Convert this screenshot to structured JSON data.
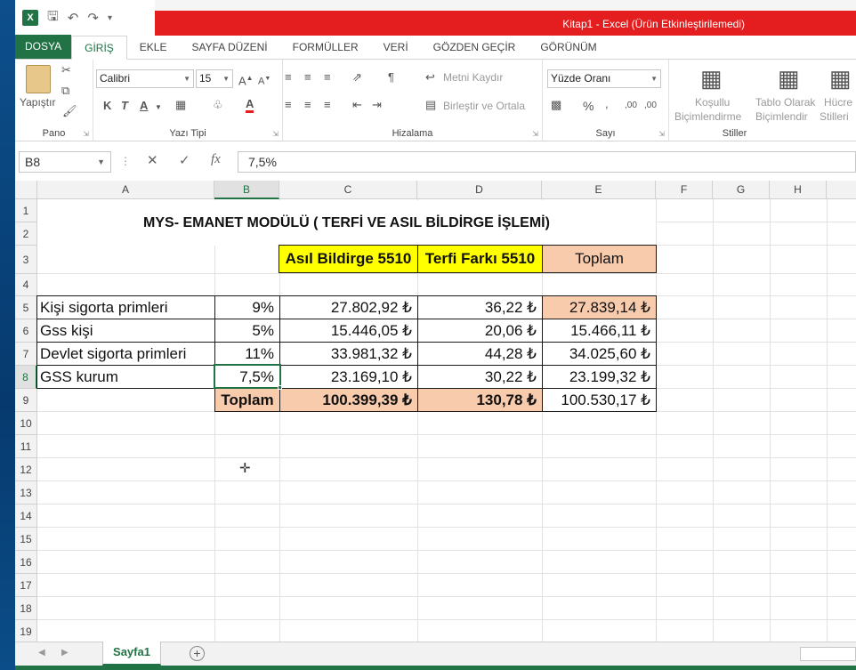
{
  "window": {
    "title": "Kitap1 -  Excel (Ürün Etkinleştirilemedi)"
  },
  "quick_access": {
    "app_icon": "X",
    "icons": [
      "save-icon",
      "undo-icon",
      "redo-icon",
      "customize-icon"
    ]
  },
  "ribbon_tabs": [
    "DOSYA",
    "GİRİŞ",
    "EKLE",
    "SAYFA DÜZENİ",
    "FORMÜLLER",
    "VERİ",
    "GÖZDEN GEÇİR",
    "GÖRÜNÜM"
  ],
  "ribbon": {
    "pano": {
      "label": "Pano",
      "paste": "Yapıştır"
    },
    "font": {
      "label": "Yazı Tipi",
      "family": "Calibri",
      "size": "15",
      "bold": "K",
      "italic": "T",
      "underline": "A"
    },
    "align": {
      "label": "Hizalama",
      "wrap": "Metni Kaydır",
      "merge": "Birleştir ve Ortala"
    },
    "number": {
      "label": "Sayı",
      "format": "Yüzde Oranı",
      "percent": "%",
      "comma": ","
    },
    "styles": {
      "label": "Stiller",
      "conditional_1": "Koşullu",
      "conditional_2": "Biçimlendirme",
      "table_1": "Tablo Olarak",
      "table_2": "Biçimlendir",
      "cell_1": "Hücre",
      "cell_2": "Stilleri"
    }
  },
  "formula_bar": {
    "name_box": "B8",
    "cancel": "✕",
    "enter": "✓",
    "fx": "fx",
    "value": "7,5%"
  },
  "columns": [
    "A",
    "B",
    "C",
    "D",
    "E",
    "F",
    "G",
    "H"
  ],
  "rows": [
    "1",
    "2",
    "3",
    "4",
    "5",
    "6",
    "7",
    "8",
    "9",
    "10",
    "11",
    "12",
    "13",
    "14",
    "15",
    "16",
    "17",
    "18",
    "19"
  ],
  "sheet": {
    "title": "MYS- EMANET MODÜLÜ ( TERFİ VE ASIL BİLDİRGE İŞLEMİ)",
    "headers": {
      "c": "Asıl Bildirge 5510",
      "d": "Terfi Farkı 5510",
      "e": "Toplam"
    },
    "data_rows": [
      {
        "label": "Kişi sigorta primleri",
        "rate": "9%",
        "asil": "27.802,92 ₺",
        "terfi": "36,22 ₺",
        "toplam": "27.839,14 ₺"
      },
      {
        "label": "Gss kişi",
        "rate": "5%",
        "asil": "15.446,05 ₺",
        "terfi": "20,06 ₺",
        "toplam": "15.466,11 ₺"
      },
      {
        "label": "Devlet sigorta primleri",
        "rate": "11%",
        "asil": "33.981,32 ₺",
        "terfi": "44,28 ₺",
        "toplam": "34.025,60 ₺"
      },
      {
        "label": "GSS kurum",
        "rate": "7,5%",
        "asil": "23.169,10 ₺",
        "terfi": "30,22 ₺",
        "toplam": "23.199,32 ₺"
      }
    ],
    "total_row": {
      "label": "Toplam",
      "asil": "100.399,39 ₺",
      "terfi": "130,78 ₺",
      "toplam": "100.530,17 ₺"
    }
  },
  "sheet_tabs": {
    "active": "Sayfa1",
    "add": "+"
  },
  "colors": {
    "excel_green": "#217346",
    "title_red": "#e41e1e",
    "yellow": "#ffff00",
    "peach": "#f8cbad"
  }
}
